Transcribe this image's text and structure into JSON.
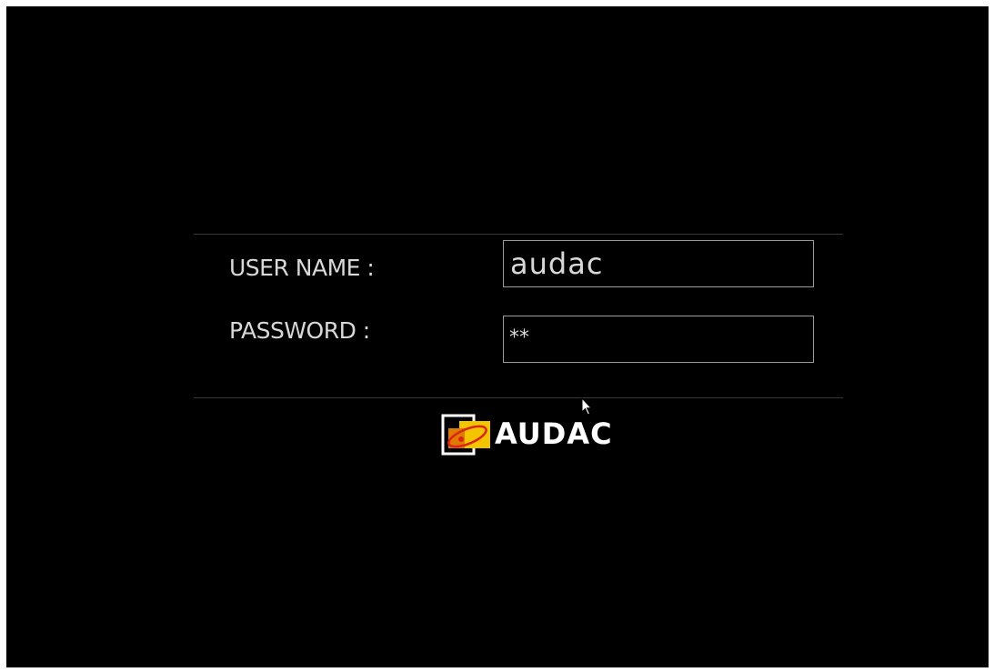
{
  "login": {
    "username_label": "USER NAME :",
    "password_label": "PASSWORD  :",
    "username_value": "audac",
    "password_value": "**"
  },
  "brand": {
    "name": "AUDAC",
    "accent_yellow": "#f5c400",
    "accent_red": "#d9241b"
  },
  "icons": {
    "cursor": "mouse-pointer-icon",
    "logo": "audac-logo-mark-icon"
  }
}
